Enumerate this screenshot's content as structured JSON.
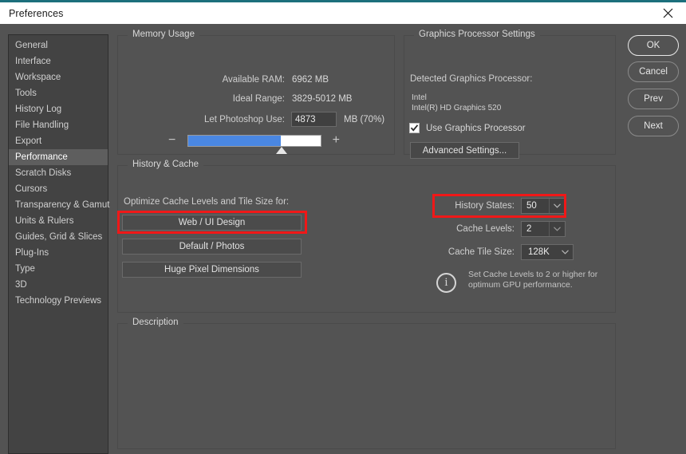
{
  "window": {
    "title": "Preferences",
    "close_icon": "close-icon",
    "accent_color": "#1c6f7c"
  },
  "sidebar": {
    "items": [
      {
        "label": "General",
        "selected": false
      },
      {
        "label": "Interface",
        "selected": false
      },
      {
        "label": "Workspace",
        "selected": false
      },
      {
        "label": "Tools",
        "selected": false
      },
      {
        "label": "History Log",
        "selected": false
      },
      {
        "label": "File Handling",
        "selected": false
      },
      {
        "label": "Export",
        "selected": false
      },
      {
        "label": "Performance",
        "selected": true
      },
      {
        "label": "Scratch Disks",
        "selected": false
      },
      {
        "label": "Cursors",
        "selected": false
      },
      {
        "label": "Transparency & Gamut",
        "selected": false
      },
      {
        "label": "Units & Rulers",
        "selected": false
      },
      {
        "label": "Guides, Grid & Slices",
        "selected": false
      },
      {
        "label": "Plug-Ins",
        "selected": false
      },
      {
        "label": "Type",
        "selected": false
      },
      {
        "label": "3D",
        "selected": false
      },
      {
        "label": "Technology Previews",
        "selected": false
      }
    ]
  },
  "memory_usage": {
    "group_title": "Memory Usage",
    "available_ram_label": "Available RAM:",
    "available_ram_value": "6962 MB",
    "ideal_range_label": "Ideal Range:",
    "ideal_range_value": "3829-5012 MB",
    "let_photoshop_use_label": "Let Photoshop Use:",
    "let_photoshop_use_value": "4873",
    "unit_suffix": "MB (70%)",
    "slider_percent": 70,
    "slider_minus": "−",
    "slider_plus": "+",
    "slider_fill_color": "#4a87e2"
  },
  "graphics": {
    "group_title": "Graphics Processor Settings",
    "detected_label": "Detected Graphics Processor:",
    "vendor": "Intel",
    "model": "Intel(R) HD Graphics 520",
    "use_gpu_label": "Use Graphics Processor",
    "use_gpu_checked": true,
    "advanced_button": "Advanced Settings..."
  },
  "history_cache": {
    "group_title": "History & Cache",
    "optimize_label": "Optimize Cache Levels and Tile Size for:",
    "preset_buttons": [
      {
        "label": "Web / UI Design",
        "highlighted": true
      },
      {
        "label": "Default / Photos",
        "highlighted": false
      },
      {
        "label": "Huge Pixel Dimensions",
        "highlighted": false
      }
    ],
    "history_states_label": "History States:",
    "history_states_value": "50",
    "cache_levels_label": "Cache Levels:",
    "cache_levels_value": "2",
    "cache_tile_size_label": "Cache Tile Size:",
    "cache_tile_size_value": "128K",
    "info_icon": "info-icon",
    "info_text": "Set Cache Levels to 2 or higher for\noptimum GPU performance."
  },
  "description": {
    "group_title": "Description",
    "body": ""
  },
  "action_buttons": [
    {
      "label": "OK",
      "primary": true
    },
    {
      "label": "Cancel",
      "primary": false
    },
    {
      "label": "Prev",
      "primary": false
    },
    {
      "label": "Next",
      "primary": false
    }
  ],
  "annotations": {
    "highlight_color": "#f01818"
  }
}
